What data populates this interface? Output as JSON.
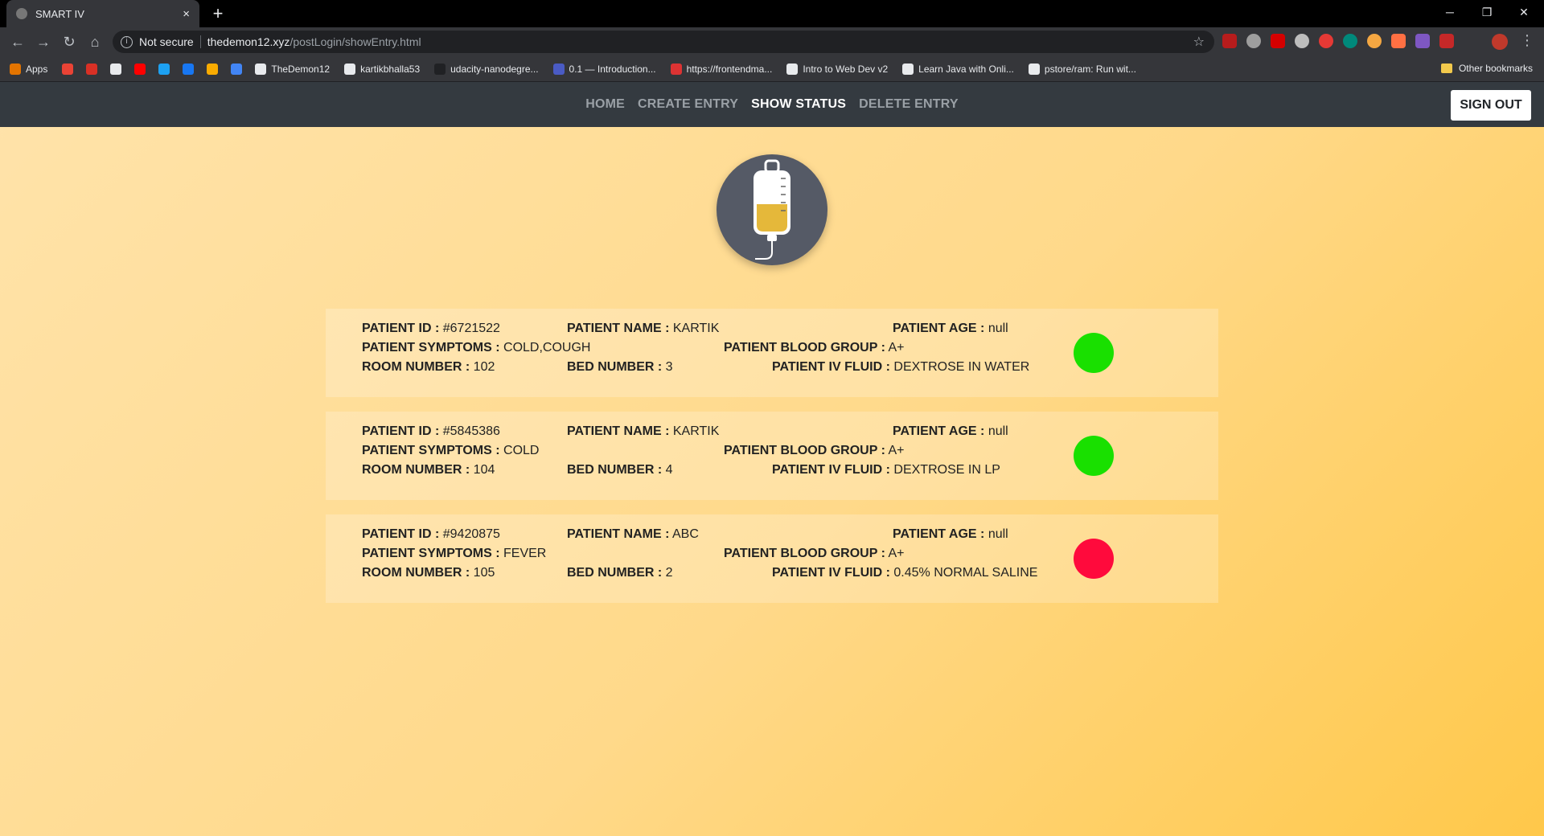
{
  "browser": {
    "tab_title": "SMART IV",
    "tab_close": "×",
    "new_tab": "+",
    "security": "Not secure",
    "url_host": "thedemon12.xyz",
    "url_path": "/postLogin/showEntry.html",
    "bookmarks": [
      {
        "label": "Apps",
        "color": "#e37400"
      },
      {
        "label": "",
        "color": "#ea4335"
      },
      {
        "label": "",
        "color": "#d93025"
      },
      {
        "label": "",
        "color": "#e8eaed"
      },
      {
        "label": "",
        "color": "#ff0000"
      },
      {
        "label": "",
        "color": "#1da1f2"
      },
      {
        "label": "",
        "color": "#1877f2"
      },
      {
        "label": "",
        "color": "#f9ab00"
      },
      {
        "label": "",
        "color": "#4285f4"
      },
      {
        "label": "TheDemon12",
        "color": "#e8eaed"
      },
      {
        "label": "kartikbhalla53",
        "color": "#e8eaed"
      },
      {
        "label": "udacity-nanodegre...",
        "color": "#202124"
      },
      {
        "label": "0.1 — Introduction...",
        "color": "#4a5bc4"
      },
      {
        "label": "https://frontendma...",
        "color": "#dd3333"
      },
      {
        "label": "Intro to Web Dev v2",
        "color": "#e8eaed"
      },
      {
        "label": "Learn Java with Onli...",
        "color": "#e8eaed"
      },
      {
        "label": "pstore/ram: Run wit...",
        "color": "#e8eaed"
      }
    ],
    "other_bookmarks": "Other bookmarks"
  },
  "nav": {
    "items": [
      {
        "label": "HOME",
        "active": false
      },
      {
        "label": "CREATE ENTRY",
        "active": false
      },
      {
        "label": "SHOW STATUS",
        "active": true
      },
      {
        "label": "DELETE ENTRY",
        "active": false
      }
    ],
    "signout": "SIGN OUT"
  },
  "labels": {
    "id": "PATIENT ID :",
    "name": "PATIENT NAME :",
    "age": "PATIENT AGE :",
    "symptoms": "PATIENT SYMPTOMS :",
    "blood": "PATIENT BLOOD GROUP :",
    "room": "ROOM NUMBER :",
    "bed": "BED NUMBER :",
    "fluid": "PATIENT IV FLUID :"
  },
  "patients": [
    {
      "id": "#6721522",
      "name": "KARTIK",
      "age": "null",
      "symptoms": "COLD,COUGH",
      "blood": "A+",
      "room": "102",
      "bed": "3",
      "fluid": "DEXTROSE IN WATER",
      "status_color": "#19e000"
    },
    {
      "id": "#5845386",
      "name": "KARTIK",
      "age": "null",
      "symptoms": "COLD",
      "blood": "A+",
      "room": "104",
      "bed": "4",
      "fluid": "DEXTROSE IN LP",
      "status_color": "#19e000"
    },
    {
      "id": "#9420875",
      "name": "ABC",
      "age": "null",
      "symptoms": "FEVER",
      "blood": "A+",
      "room": "105",
      "bed": "2",
      "fluid": "0.45% NORMAL SALINE",
      "status_color": "#ff0a3c"
    }
  ]
}
